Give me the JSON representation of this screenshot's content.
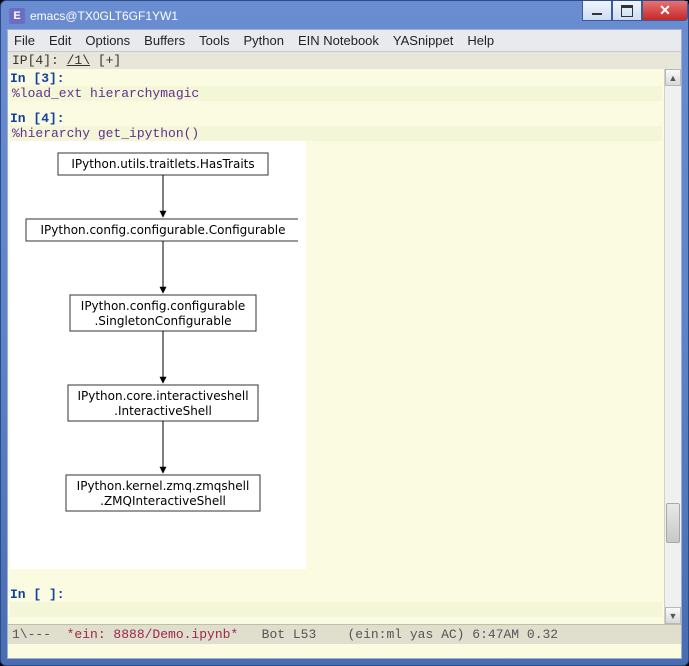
{
  "window": {
    "title": "emacs@TX0GLT6GF1YW1"
  },
  "menubar": {
    "items": [
      "File",
      "Edit",
      "Options",
      "Buffers",
      "Tools",
      "Python",
      "EIN Notebook",
      "YASnippet",
      "Help"
    ]
  },
  "header": {
    "prefix": "IP[4]: ",
    "tab": "/1\\",
    "add": " [+]"
  },
  "cells": [
    {
      "prompt": "In [3]:",
      "code": "%load_ext hierarchymagic"
    },
    {
      "prompt": "In [4]:",
      "code": "%hierarchy get_ipython()"
    },
    {
      "prompt": "In [ ]:",
      "code": ""
    }
  ],
  "hierarchy_nodes": [
    {
      "lines": [
        "IPython.utils.traitlets.HasTraits"
      ]
    },
    {
      "lines": [
        "IPython.config.configurable.Configurable"
      ]
    },
    {
      "lines": [
        "IPython.config.configurable",
        ".SingletonConfigurable"
      ]
    },
    {
      "lines": [
        "IPython.core.interactiveshell",
        ".InteractiveShell"
      ]
    },
    {
      "lines": [
        "IPython.kernel.zmq.zmqshell",
        ".ZMQInteractiveShell"
      ]
    }
  ],
  "modeline": {
    "left": "1\\---  ",
    "buffer": "*ein: 8888/Demo.ipynb*",
    "rest": "   Bot L53    (ein:ml yas AC) 6:47AM 0.32"
  }
}
